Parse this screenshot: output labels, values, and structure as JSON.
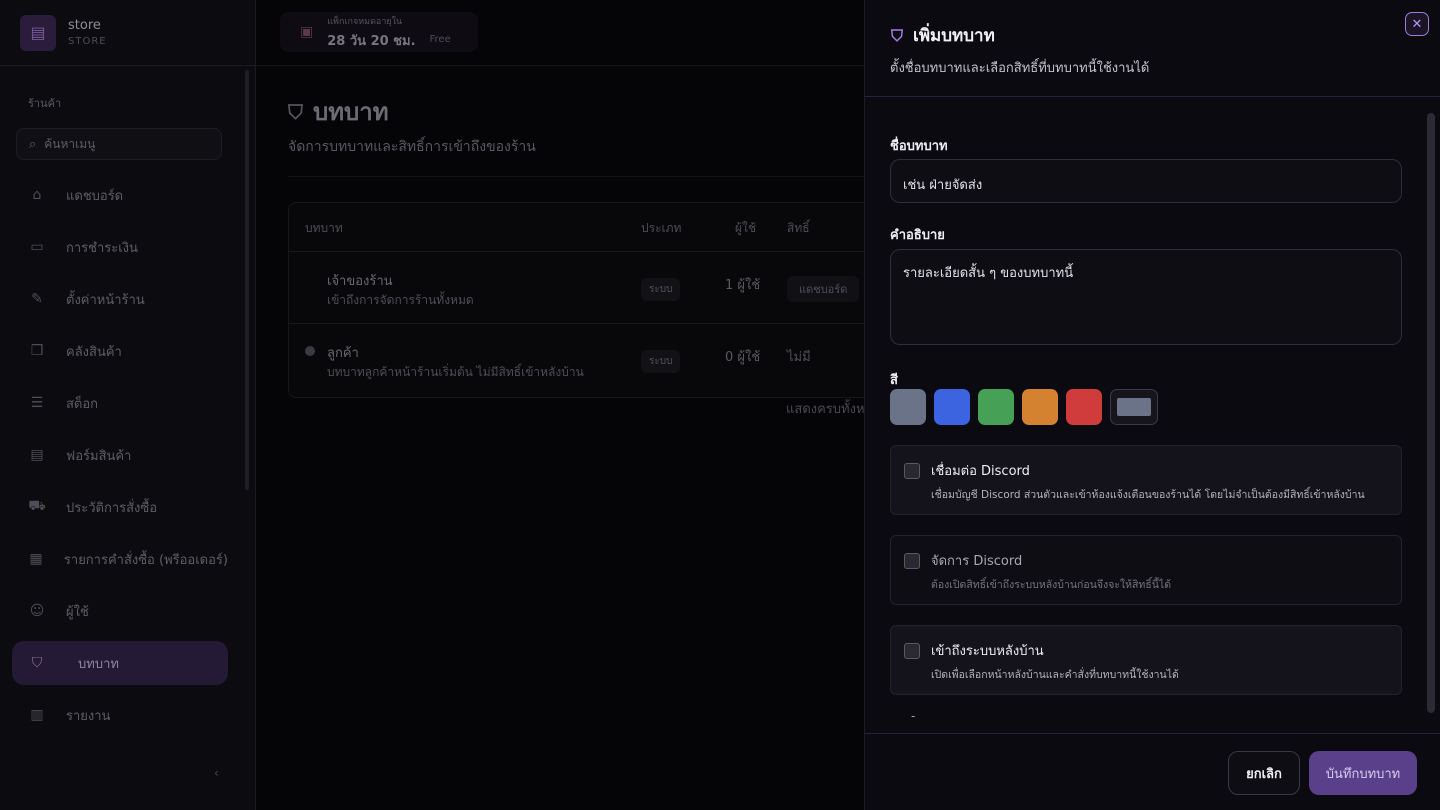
{
  "sidebar": {
    "store_name": "store",
    "store_code": "STORE",
    "section_label": "ร้านค้า",
    "search_placeholder": "ค้นหาเมนู",
    "items": [
      {
        "label": "แดชบอร์ด",
        "icon": "home-icon"
      },
      {
        "label": "การชำระเงิน",
        "icon": "credit-card-icon"
      },
      {
        "label": "ตั้งค่าหน้าร้าน",
        "icon": "brush-icon"
      },
      {
        "label": "คลังสินค้า",
        "icon": "boxes-icon"
      },
      {
        "label": "สต็อก",
        "icon": "database-icon"
      },
      {
        "label": "ฟอร์มสินค้า",
        "icon": "document-icon"
      },
      {
        "label": "ประวัติการสั่งซื้อ",
        "icon": "cart-icon"
      },
      {
        "label": "รายการคำสั่งซื้อ (พรีออเดอร์)",
        "icon": "clipboard-icon"
      },
      {
        "label": "ผู้ใช้",
        "icon": "users-icon"
      },
      {
        "label": "บทบาท",
        "icon": "shield-icon"
      },
      {
        "label": "รายงาน",
        "icon": "chart-icon"
      }
    ],
    "active_index": 9
  },
  "topbar": {
    "package_label": "แพ็กเกจหมดอายุใน",
    "package_remaining": "28 วัน 20 ชม.",
    "package_tier": "Free"
  },
  "page": {
    "title": "บทบาท",
    "subtitle": "จัดการบทบาทและสิทธิ์การเข้าถึงของร้าน",
    "columns": [
      "บทบาท",
      "ประเภท",
      "ผู้ใช้",
      "สิทธิ์"
    ],
    "rows": [
      {
        "name": "เจ้าของร้าน",
        "desc": "เข้าถึงการจัดการร้านทั้งหมด",
        "type": "ระบบ",
        "users": "1 ผู้ใช้",
        "perm": "แดชบอร์ด"
      },
      {
        "name": "ลูกค้า",
        "desc": "บทบาทลูกค้าหน้าร้านเริ่มต้น ไม่มีสิทธิ์เข้าหลังบ้าน",
        "type": "ระบบ",
        "users": "0 ผู้ใช้",
        "perm": "ไม่มี"
      }
    ],
    "footer_text": "แสดงครบทั้งห"
  },
  "drawer": {
    "title": "เพิ่มบทบาท",
    "subtitle": "ตั้งชื่อบทบาทและเลือกสิทธิ์ที่บทบาทนี้ใช้งานได้",
    "name_label": "ชื่อบทบาท",
    "name_placeholder": "เช่น ฝ่ายจัดส่ง",
    "desc_label": "คำอธิบาย",
    "desc_placeholder": "รายละเอียดสั้น ๆ ของบทบาทนี้",
    "color_label": "สี",
    "colors": [
      "#6b7388",
      "#3c63e0",
      "#46a055",
      "#d48230",
      "#d03c3c"
    ],
    "custom_color": "#6b7388",
    "permissions": [
      {
        "title": "เชื่อมต่อ Discord",
        "desc": "เชื่อมบัญชี Discord ส่วนตัวและเข้าห้องแจ้งเตือนของร้านได้ โดยไม่จำเป็นต้องมีสิทธิ์เข้าหลังบ้าน",
        "checked": false,
        "disabled": false
      },
      {
        "title": "จัดการ Discord",
        "desc": "ต้องเปิดสิทธิ์เข้าถึงระบบหลังบ้านก่อนจึงจะให้สิทธิ์นี้ได้",
        "checked": false,
        "disabled": true
      },
      {
        "title": "เข้าถึงระบบหลังบ้าน",
        "desc": "เปิดเพื่อเลือกหน้าหลังบ้านและคำสั่งที่บทบาทนี้ใช้งานได้",
        "checked": false,
        "disabled": false
      }
    ],
    "dash": "-",
    "cancel_label": "ยกเลิก",
    "save_label": "บันทึกบทบาท"
  }
}
